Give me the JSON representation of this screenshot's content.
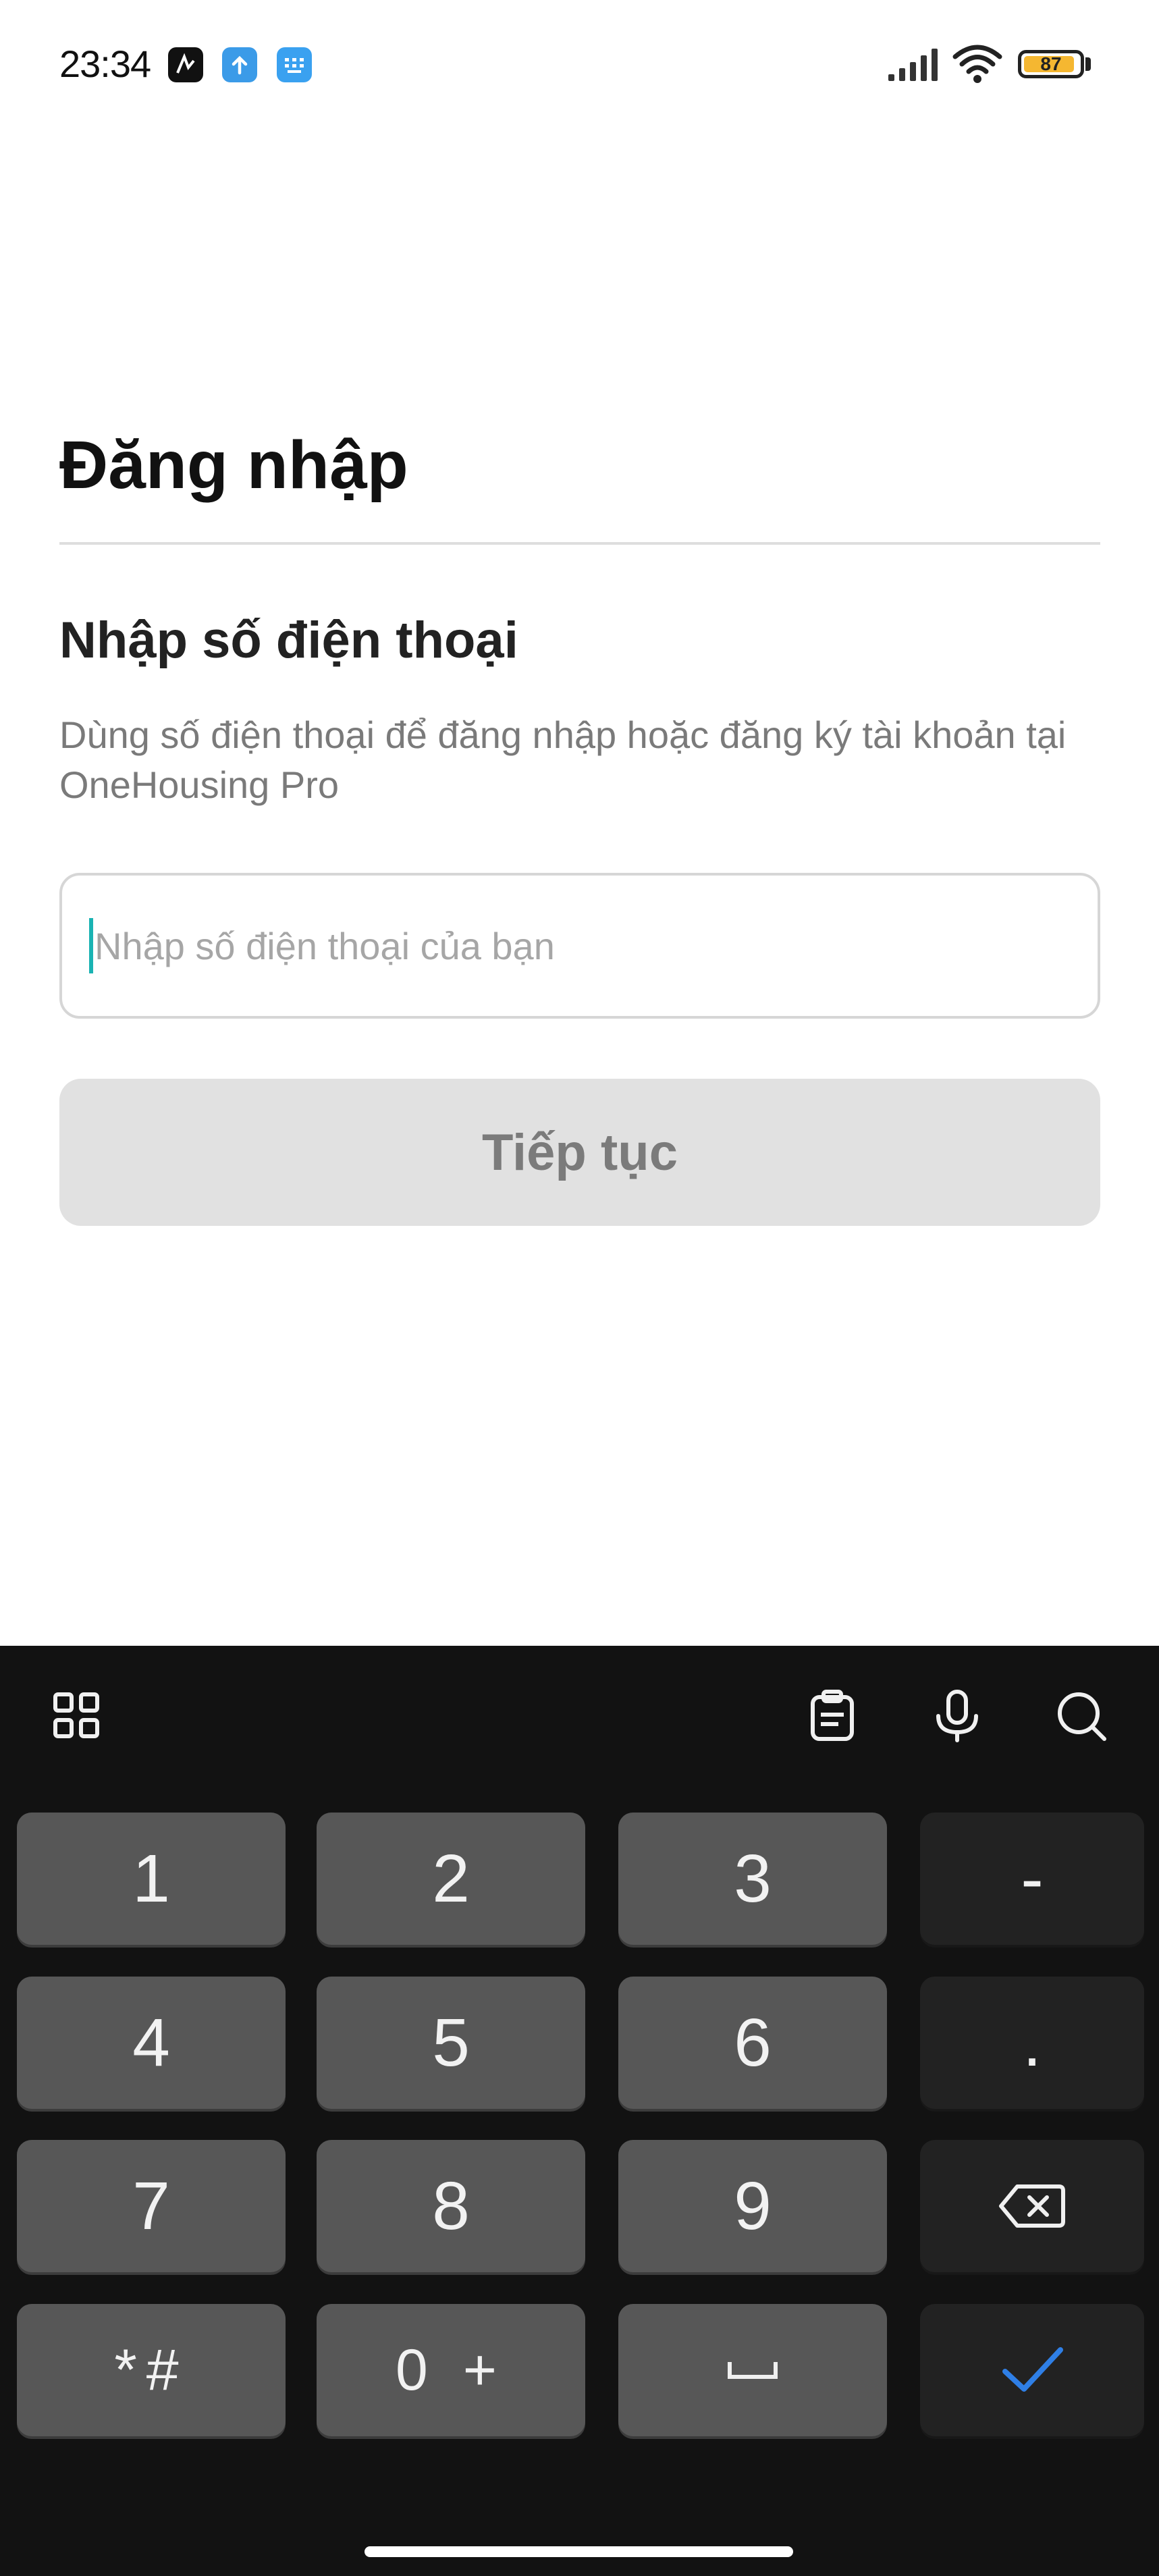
{
  "status_bar": {
    "time": "23:34",
    "battery_level": "87",
    "icons": [
      "notification-app-icon",
      "upload-icon",
      "keyboard-app-icon",
      "signal-icon",
      "wifi-icon",
      "battery-icon"
    ]
  },
  "login": {
    "title": "Đăng nhập",
    "heading": "Nhập số điện thoại",
    "description": "Dùng số điện thoại để đăng nhập hoặc đăng ký tài khoản tại OneHousing Pro",
    "phone_input": {
      "value": "",
      "placeholder": "Nhập số điện thoại của bạn"
    },
    "continue_label": "Tiếp tục"
  },
  "keyboard": {
    "toolbar": [
      "apps-grid-icon",
      "clipboard-icon",
      "microphone-icon",
      "search-icon"
    ],
    "keys": {
      "k1": "1",
      "k2": "2",
      "k3": "3",
      "dash": "-",
      "k4": "4",
      "k5": "5",
      "k6": "6",
      "dot": ".",
      "k7": "7",
      "k8": "8",
      "k9": "9",
      "backspace": "backspace-icon",
      "symbols": "*#",
      "k0": "0 +",
      "space": "space-icon",
      "done": "check-icon"
    }
  },
  "colors": {
    "accent": "#1ab3b3",
    "keyboard_bg": "#121212",
    "key_bg": "#575757",
    "done_check": "#2f7fe6",
    "battery": "#f5b731"
  }
}
